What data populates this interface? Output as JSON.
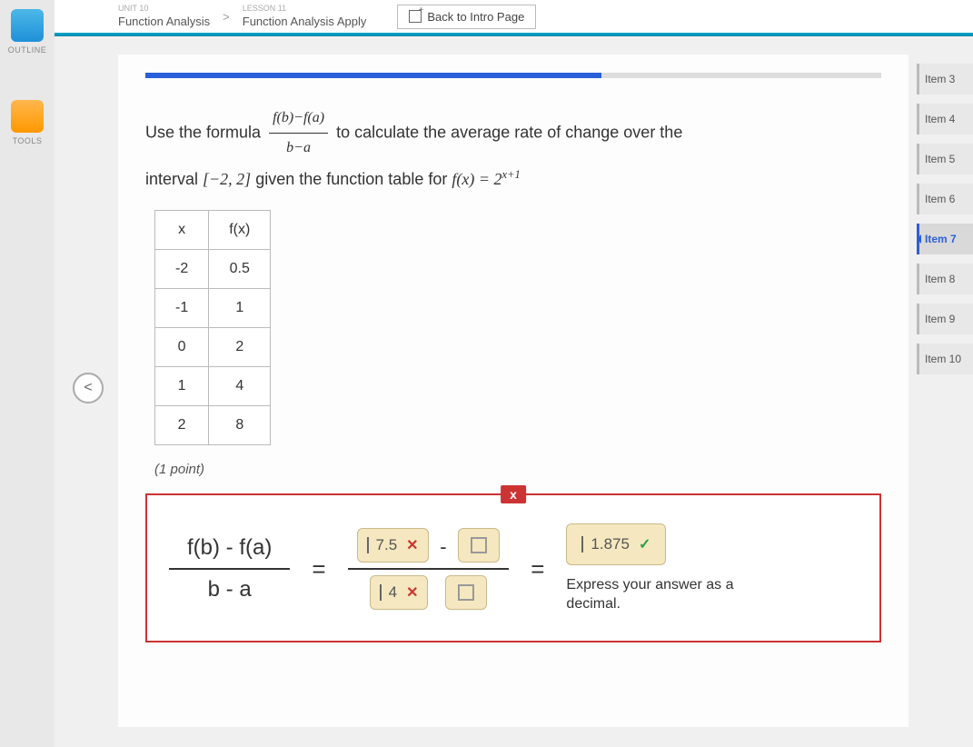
{
  "breadcrumb": {
    "unit_label": "UNIT 10",
    "unit_name": "Function Analysis",
    "sep": ">",
    "lesson_label": "LESSON 11",
    "lesson_name": "Function Analysis Apply",
    "back_btn": "Back to Intro Page"
  },
  "left_rail": {
    "outline": "OUTLINE",
    "tools": "TOOLS"
  },
  "prompt": {
    "p1a": "Use the formula ",
    "frac_num": "f(b)−f(a)",
    "frac_den": "b−a",
    "p1b": " to calculate the average rate of change over the",
    "p2a": "interval ",
    "interval": "[−2, 2]",
    "p2b": " given the function table for ",
    "fn_lhs": "f(x) = 2",
    "fn_exp": "x+1"
  },
  "table": {
    "head_x": "x",
    "head_fx": "f(x)",
    "rows": [
      {
        "x": "-2",
        "fx": "0.5"
      },
      {
        "x": "-1",
        "fx": "1"
      },
      {
        "x": "0",
        "fx": "2"
      },
      {
        "x": "1",
        "fx": "4"
      },
      {
        "x": "2",
        "fx": "8"
      }
    ]
  },
  "points_label": "(1 point)",
  "answer": {
    "wrong_chip": "x",
    "formula_num": "f(b) - f(a)",
    "formula_den": "b - a",
    "eq": "=",
    "slot_num1": "7.5",
    "slot_num1_mark": "✕",
    "minus": "-",
    "slot_den1": "4",
    "slot_den1_mark": "✕",
    "slot_final": "1.875",
    "slot_final_mark": "✓",
    "hint": "Express your answer as a decimal."
  },
  "items": [
    {
      "label": "Item 3"
    },
    {
      "label": "Item 4"
    },
    {
      "label": "Item 5"
    },
    {
      "label": "Item 6"
    },
    {
      "label": "Item 7",
      "active": true
    },
    {
      "label": "Item 8"
    },
    {
      "label": "Item 9"
    },
    {
      "label": "Item 10"
    }
  ],
  "collapse": "<"
}
